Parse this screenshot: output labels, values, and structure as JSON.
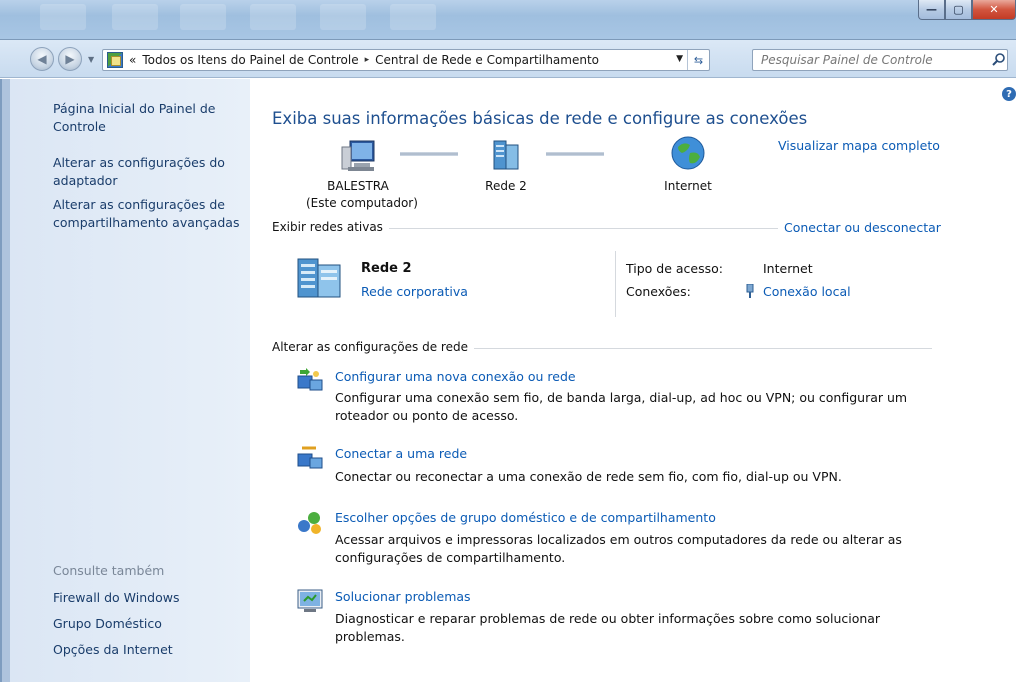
{
  "window": {
    "minimize_glyph": "—",
    "maximize_glyph": "▢",
    "close_glyph": "✕"
  },
  "nav": {
    "back_glyph": "◀",
    "forward_glyph": "▶",
    "address": {
      "prefix": "«",
      "breadcrumb": [
        "Todos os Itens do Painel de Controle",
        "Central de Rede e Compartilhamento"
      ],
      "separator": "▸"
    },
    "search_placeholder": "Pesquisar Painel de Controle"
  },
  "sidebar": {
    "links": [
      "Página Inicial do Painel de Controle",
      "Alterar as configurações do adaptador",
      "Alterar as configurações de compartilhamento avançadas"
    ],
    "see_also_heading": "Consulte também",
    "see_also_links": [
      "Firewall do Windows",
      "Grupo Doméstico",
      "Opções da Internet"
    ]
  },
  "main": {
    "heading": "Exiba suas informações básicas de rede e configure as conexões",
    "map_link": "Visualizar mapa completo",
    "map_nodes": [
      {
        "label": "BALESTRA",
        "sublabel": "(Este computador)",
        "icon": "computer-icon"
      },
      {
        "label": "Rede  2",
        "icon": "network-icon"
      },
      {
        "label": "Internet",
        "icon": "globe-icon"
      }
    ],
    "active_networks": {
      "label": "Exibir redes ativas",
      "action_link": "Conectar ou desconectar",
      "network_name": "Rede  2",
      "network_type": "Rede corporativa",
      "access_type_key": "Tipo de acesso:",
      "access_type_value": "Internet",
      "connections_key": "Conexões:",
      "connections_value": "Conexão local"
    },
    "change_settings": {
      "label": "Alterar as configurações de rede",
      "tasks": [
        {
          "title": "Configurar uma nova conexão ou rede",
          "desc1": "Configurar uma conexão sem fio, de banda larga, dial-up, ad hoc ou VPN; ou configurar um",
          "desc2": "roteador ou ponto de acesso.",
          "icon": "new-connection-icon"
        },
        {
          "title": "Conectar a uma rede",
          "desc1": "Conectar ou reconectar a uma conexão de rede sem fio, com fio, dial-up ou VPN.",
          "desc2": "",
          "icon": "connect-network-icon"
        },
        {
          "title": "Escolher opções de grupo doméstico e de compartilhamento",
          "desc1": "Acessar arquivos e impressoras localizados em outros computadores da rede ou alterar as",
          "desc2": "configurações de compartilhamento.",
          "icon": "homegroup-icon"
        },
        {
          "title": "Solucionar problemas",
          "desc1": "Diagnosticar e reparar problemas de rede ou obter informações sobre como solucionar problemas.",
          "desc2": "",
          "icon": "troubleshoot-icon"
        }
      ]
    },
    "help_glyph": "?"
  },
  "colors": {
    "link": "#0b5bb5",
    "heading": "#1e4f8f",
    "sidebar_bg": "#dbe6f4"
  }
}
